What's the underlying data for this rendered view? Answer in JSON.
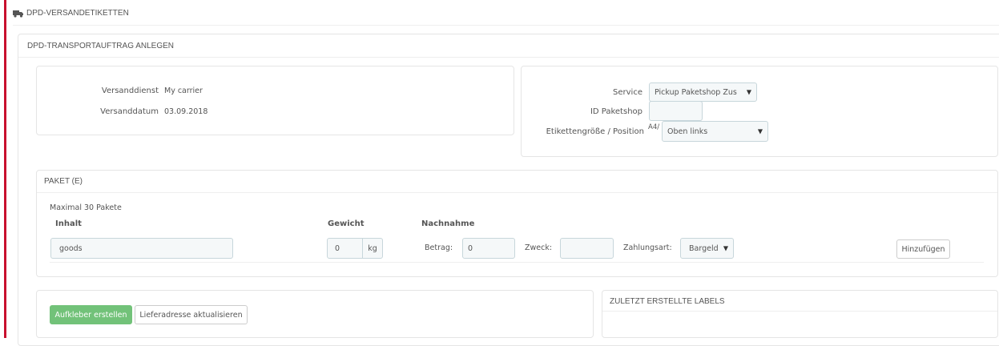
{
  "header": {
    "title": "DPD-VERSANDETIKETTEN",
    "icon": "truck-icon"
  },
  "panel": {
    "title": "DPD-TRANSPORTAUFTRAG ANLEGEN"
  },
  "shipment": {
    "carrier_label": "Versanddienst",
    "carrier_value": "My carrier",
    "date_label": "Versanddatum",
    "date_value": "03.09.2018"
  },
  "service": {
    "service_label": "Service",
    "service_value": "Pickup Paketshop Zus",
    "parcelshop_label": "ID Paketshop",
    "parcelshop_value": "",
    "label_size_label": "Etikettengröße / Position",
    "label_size_prefix": "A4/",
    "label_position_value": "Oben links"
  },
  "paket": {
    "title": "PAKET (E)",
    "max_note": "Maximal 30 Pakete",
    "col_content": "Inhalt",
    "col_weight": "Gewicht",
    "col_cod": "Nachnahme",
    "content_value": "goods",
    "weight_value": "0",
    "weight_unit": "kg",
    "amount_label": "Betrag:",
    "amount_value": "0",
    "purpose_label": "Zweck:",
    "purpose_value": "",
    "payment_label": "Zahlungsart:",
    "payment_value": "Bargeld",
    "add_button": "Hinzufügen"
  },
  "actions": {
    "create_button": "Aufkleber erstellen",
    "update_address_button": "Lieferadresse aktualisieren"
  },
  "recent": {
    "title": "ZULETZT ERSTELLTE LABELS"
  },
  "colors": {
    "accent": "#c8102e",
    "success": "#72c279",
    "input_bg": "#f5f8f9"
  }
}
